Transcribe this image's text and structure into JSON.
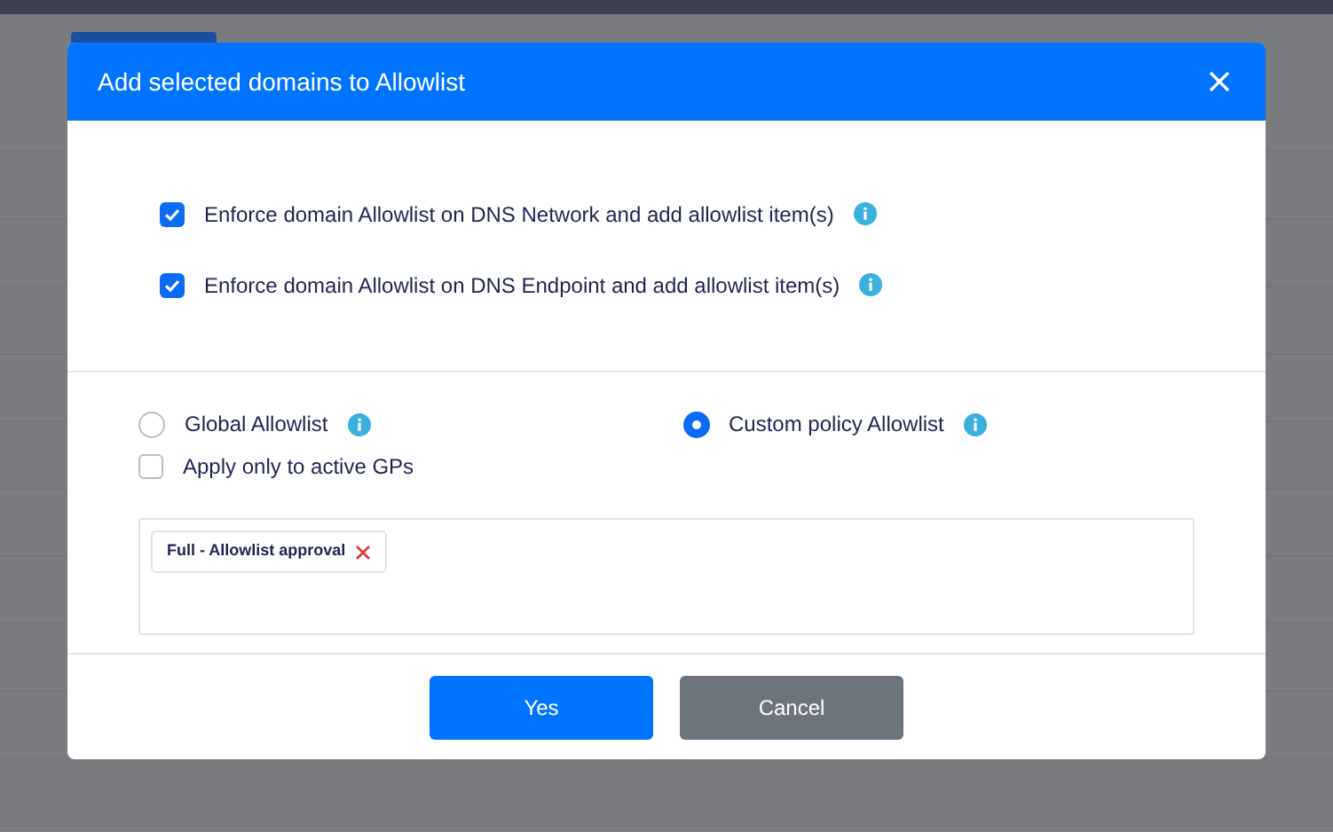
{
  "dialog": {
    "title": "Add selected domains to Allowlist",
    "enforce_options": [
      {
        "label": "Enforce domain Allowlist on DNS Network and add allowlist item(s)",
        "checked": true
      },
      {
        "label": "Enforce domain Allowlist on DNS Endpoint and add allowlist item(s)",
        "checked": true
      }
    ],
    "scope": [
      {
        "label": "Global Allowlist",
        "selected": false
      },
      {
        "label": "Custom policy Allowlist",
        "selected": true
      }
    ],
    "active_gps": {
      "label": "Apply only to active GPs",
      "checked": false
    },
    "policies": [
      {
        "label": "Full - Allowlist approval"
      }
    ],
    "buttons": [
      {
        "label": "Yes",
        "kind": "primary"
      },
      {
        "label": "Cancel",
        "kind": "secondary"
      }
    ]
  }
}
